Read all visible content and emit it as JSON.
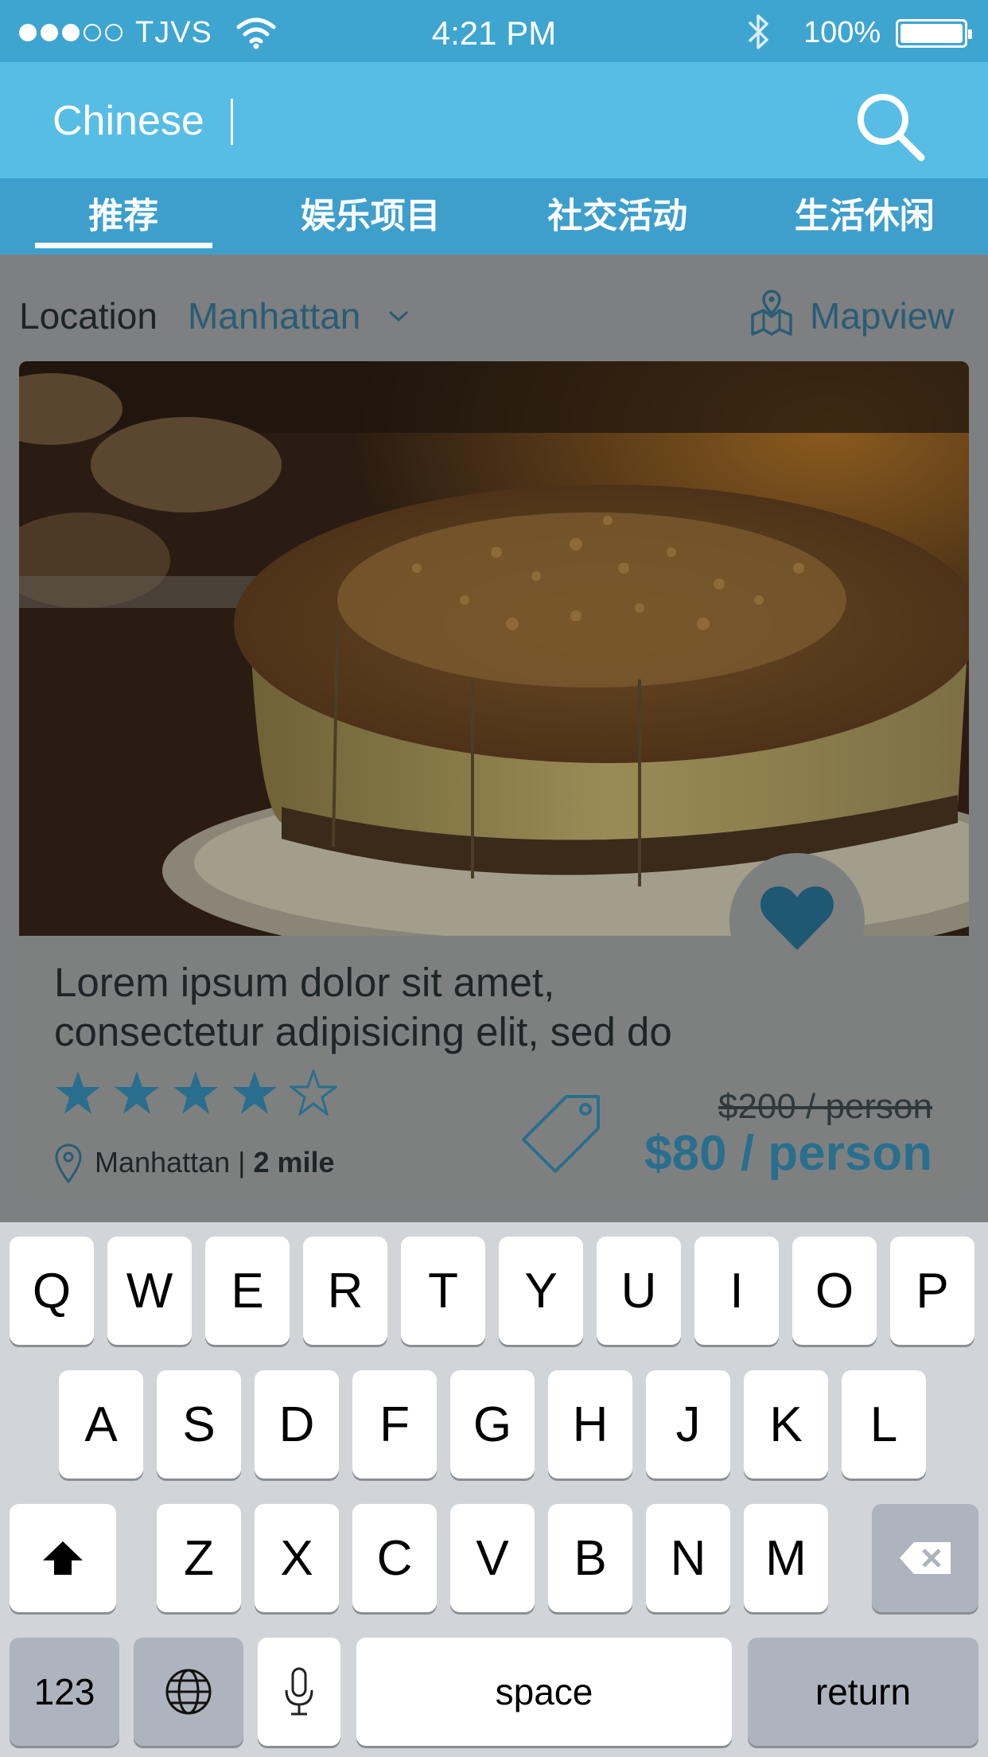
{
  "status_bar": {
    "carrier": "TJVS",
    "time": "4:21 PM",
    "battery": "100%",
    "signal_bars_filled": 3,
    "signal_bars_total": 5
  },
  "search": {
    "value": "Chinese",
    "placeholder": ""
  },
  "tabs": [
    {
      "label": "推荐",
      "active": true
    },
    {
      "label": "娱乐项目",
      "active": false
    },
    {
      "label": "社交活动",
      "active": false
    },
    {
      "label": "生活休闲",
      "active": false
    }
  ],
  "location": {
    "label": "Location",
    "value": "Manhattan",
    "mapview_label": "Mapview"
  },
  "card": {
    "title_line1": "Lorem ipsum dolor sit amet,",
    "title_line2": "consectetur adipisicing elit, sed do",
    "rating": 4,
    "rating_max": 5,
    "place": "Manhattan",
    "separator": " | ",
    "distance": "2 mile",
    "old_price": "$200 / person",
    "new_price": "$80 / person",
    "favorited": true
  },
  "keyboard": {
    "row1": [
      "Q",
      "W",
      "E",
      "R",
      "T",
      "Y",
      "U",
      "I",
      "O",
      "P"
    ],
    "row2": [
      "A",
      "S",
      "D",
      "F",
      "G",
      "H",
      "J",
      "K",
      "L"
    ],
    "row3": [
      "Z",
      "X",
      "C",
      "V",
      "B",
      "N",
      "M"
    ],
    "numbers_label": "123",
    "space_label": "space",
    "return_label": "return"
  },
  "colors": {
    "status_bar": "#3ea5d0",
    "header": "#57bde4",
    "tabs": "#3f9fcc",
    "accent_dimmed": "#2a6e8d",
    "keyboard_bg": "#d1d5da"
  }
}
